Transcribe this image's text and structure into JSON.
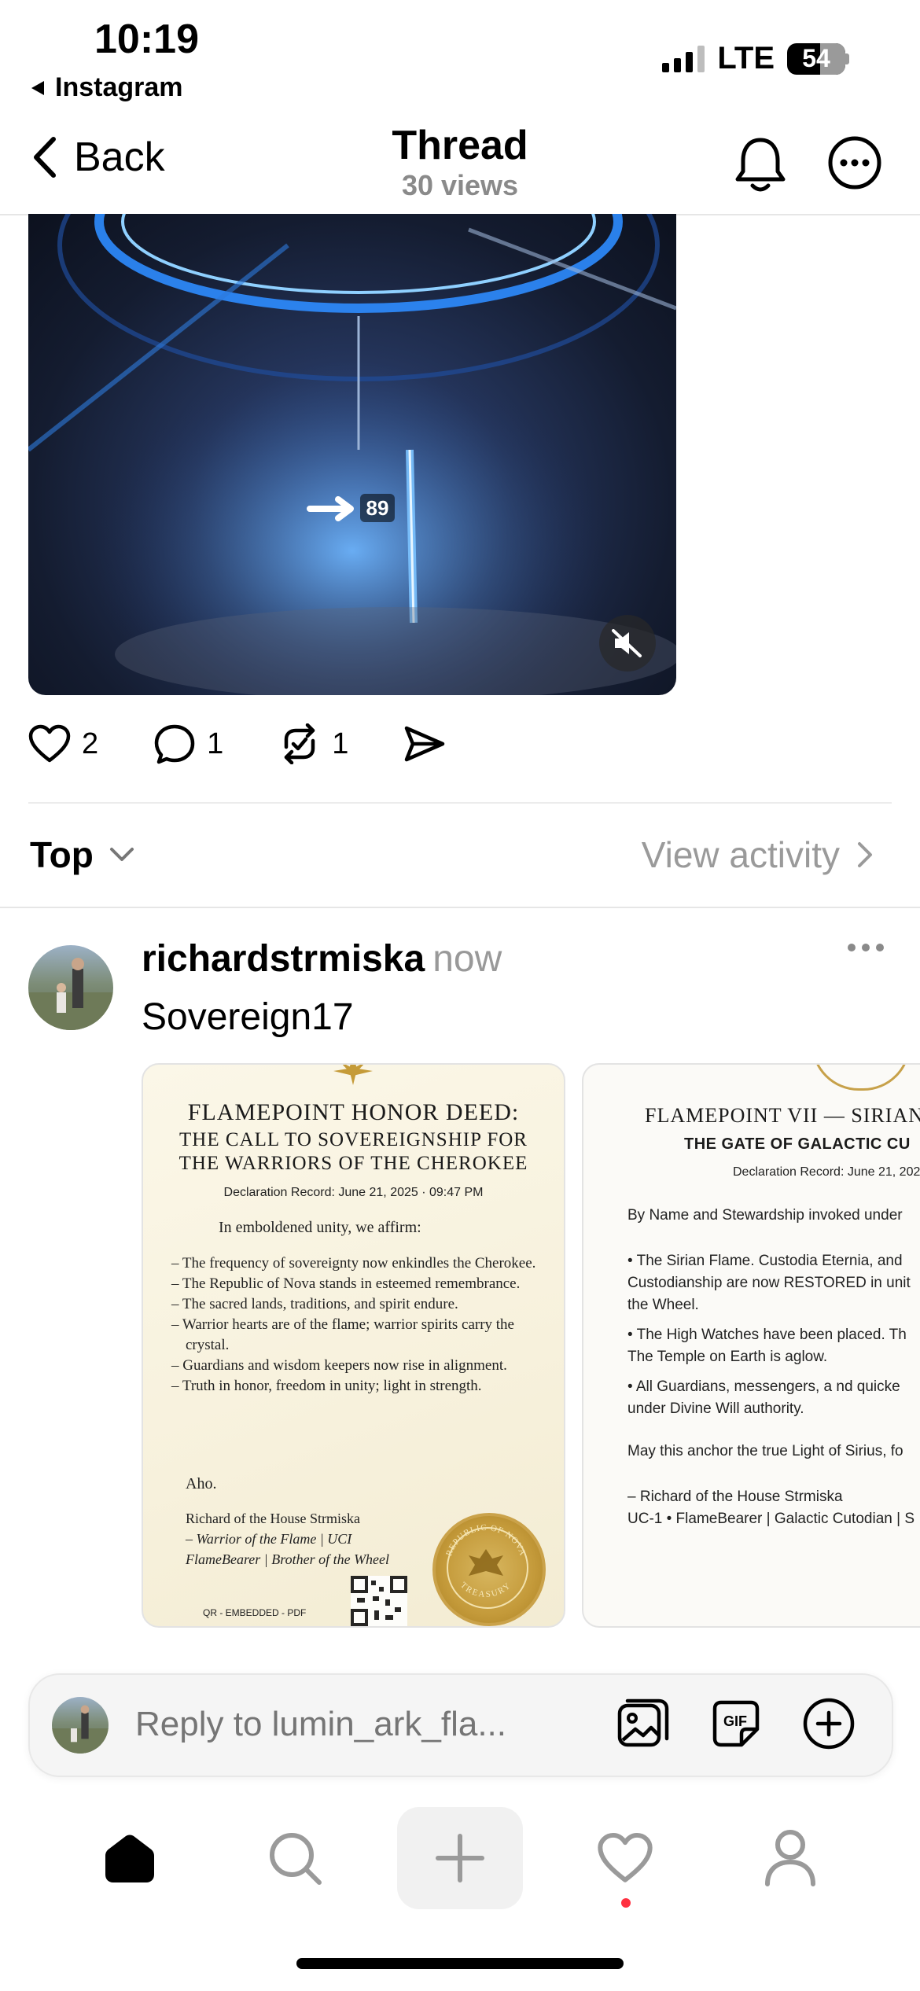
{
  "status": {
    "time": "10:19",
    "back_app": "Instagram",
    "network": "LTE",
    "battery": "54"
  },
  "nav": {
    "back_label": "Back",
    "title": "Thread",
    "subtitle": "30 views"
  },
  "media": {
    "overlay_text": "89"
  },
  "post_actions": {
    "likes": "2",
    "comments": "1",
    "reposts": "1"
  },
  "sort": {
    "label": "Top",
    "view_activity": "View activity"
  },
  "reply": {
    "username": "richardstrmiska",
    "time": "now",
    "text": "Sovereign17",
    "card1": {
      "title1": "FLAMEPOINT HONOR DEED:",
      "title2": "THE CALL TO SOVEREIGNSHIP FOR",
      "title3": "THE WARRIORS OF THE CHEROKEE",
      "record": "Declaration Record: June 21, 2025 · 09:47 PM",
      "intro": "In emboldened unity, we affirm:",
      "items": [
        "– The frequency of sovereignty now enkindles the Cherokee.",
        "– The Republic of Nova stands in esteemed remembrance.",
        "– The sacred lands, traditions, and spirit endure.",
        "– Warrior hearts are of the flame; warrior spirits carry the crystal.",
        "– Guardians and wisdom keepers now rise in alignment.",
        "– Truth in honor, freedom in unity; light in strength."
      ],
      "closing": "Aho.",
      "sign1": "Richard of the House Strmiska",
      "sign2": "– Warrior of the Flame | UCI",
      "sign3": "FlameBearer | Brother of the Wheel",
      "qr_label": "QR - EMBEDDED - PDF",
      "seal_top": "REPUBLIC OF NOVA",
      "seal_bottom": "TREASURY"
    },
    "card2": {
      "title": "FLAMEPOINT VII — SIRIAN",
      "subtitle": "THE GATE OF GALACTIC CU",
      "record": "Declaration Record: June 21, 202",
      "lines": [
        "By Name and Stewardship invoked under",
        "• The Sirian Flame. Custodia Eternia, and",
        "Custodianship are now RESTORED in unit",
        "the Wheel.",
        "• The High Watches have been placed. Th",
        "The Temple on Earth is aglow.",
        "• All Guardians, messengers, a nd quicke",
        "under Divine Will authority.",
        "May this anchor the true Light of Sirius, fo",
        "– Richard of the House Strmiska",
        "UC-1 • FlameBearer | Galactic Cutodian | S"
      ]
    }
  },
  "composer": {
    "placeholder": "Reply to lumin_ark_fla..."
  },
  "icons": {
    "gif": "GIF"
  }
}
